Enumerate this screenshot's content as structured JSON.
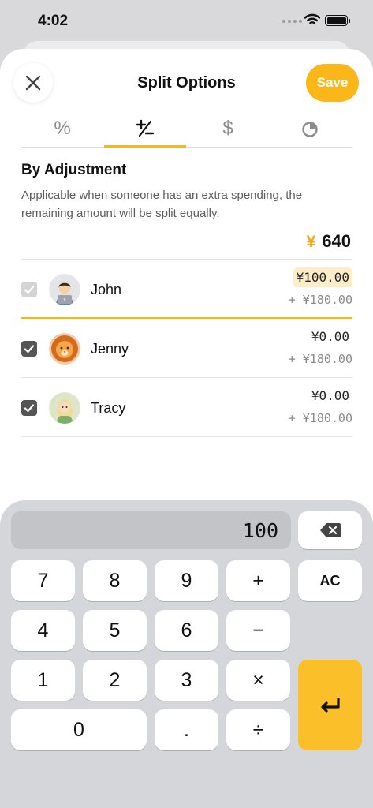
{
  "status_bar": {
    "time": "4:02"
  },
  "header": {
    "title": "Split Options",
    "save_label": "Save"
  },
  "tabs": [
    {
      "glyph": "%",
      "icon": "percent-icon",
      "active": false
    },
    {
      "glyph": "+⁄−",
      "icon": "plus-minus-icon",
      "active": true
    },
    {
      "glyph": "$",
      "icon": "dollar-icon",
      "active": false
    },
    {
      "glyph": "◔",
      "icon": "pie-icon",
      "active": false
    }
  ],
  "section": {
    "title": "By Adjustment",
    "description": "Applicable when someone has an extra spending, the remaining amount will be split equally."
  },
  "total": {
    "currency": "¥",
    "amount": "640"
  },
  "people": [
    {
      "name": "John",
      "adjustment": "¥100.00",
      "share": "+ ¥180.00",
      "checked": true,
      "disabled": true,
      "selected": true,
      "avatar": "man-with-laptop"
    },
    {
      "name": "Jenny",
      "adjustment": "¥0.00",
      "share": "+ ¥180.00",
      "checked": true,
      "disabled": false,
      "selected": false,
      "avatar": "lion"
    },
    {
      "name": "Tracy",
      "adjustment": "¥0.00",
      "share": "+ ¥180.00",
      "checked": true,
      "disabled": false,
      "selected": false,
      "avatar": "elf-girl"
    }
  ],
  "keypad": {
    "display": "100",
    "keys": {
      "seven": "7",
      "eight": "8",
      "nine": "9",
      "plus": "+",
      "clear": "AC",
      "four": "4",
      "five": "5",
      "six": "6",
      "minus": "−",
      "one": "1",
      "two": "2",
      "three": "3",
      "multiply": "×",
      "zero": "0",
      "dot": ".",
      "divide": "÷"
    }
  },
  "colors": {
    "accent": "#fbb71a",
    "highlight": "#fdeec9",
    "keypad_bg": "#d5d6da"
  }
}
